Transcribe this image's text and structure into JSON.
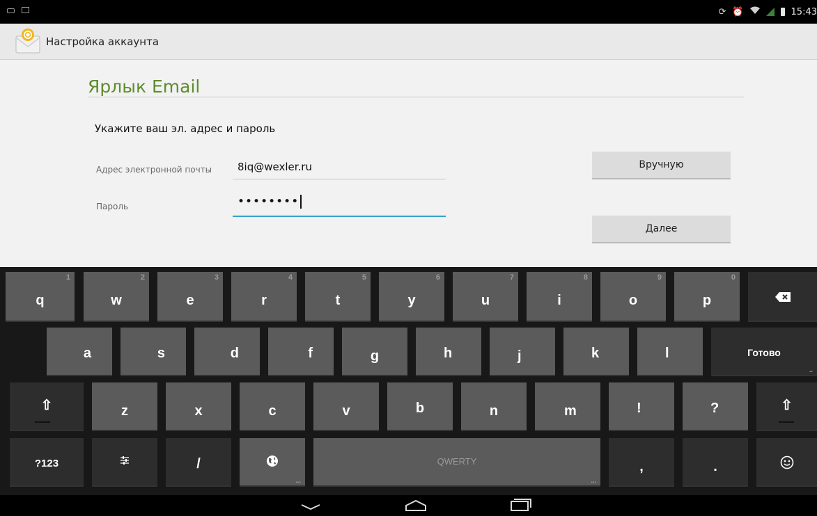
{
  "status_bar": {
    "time": "15:43"
  },
  "action_bar": {
    "title": "Настройка аккаунта"
  },
  "page": {
    "title": "Ярлык Email",
    "prompt": "Укажите ваш эл. адрес и пароль",
    "email_label": "Адрес электронной почты",
    "email_value": "8iq@wexler.ru",
    "password_label": "Пароль",
    "password_value": "••••••••",
    "manual_button": "Вручную",
    "next_button": "Далее"
  },
  "keyboard": {
    "row1": [
      {
        "key": "q",
        "hint": "1"
      },
      {
        "key": "w",
        "hint": "2"
      },
      {
        "key": "e",
        "hint": "3"
      },
      {
        "key": "r",
        "hint": "4"
      },
      {
        "key": "t",
        "hint": "5"
      },
      {
        "key": "y",
        "hint": "6"
      },
      {
        "key": "u",
        "hint": "7"
      },
      {
        "key": "i",
        "hint": "8"
      },
      {
        "key": "o",
        "hint": "9"
      },
      {
        "key": "p",
        "hint": "0"
      }
    ],
    "row2": [
      "a",
      "s",
      "d",
      "f",
      "g",
      "h",
      "j",
      "k",
      "l"
    ],
    "done_label": "Готово",
    "row3": [
      "z",
      "x",
      "c",
      "v",
      "b",
      "n",
      "m",
      "!",
      "?"
    ],
    "symbols_label": "?123",
    "slash_label": "/",
    "space_label": "QWERTY",
    "comma_label": ",",
    "period_label": "."
  },
  "colors": {
    "accent_green": "#5e8c2d",
    "focus_blue": "#33a3c9",
    "key_bg": "#5b5b5b",
    "key_dark_bg": "#2d2d2d"
  }
}
